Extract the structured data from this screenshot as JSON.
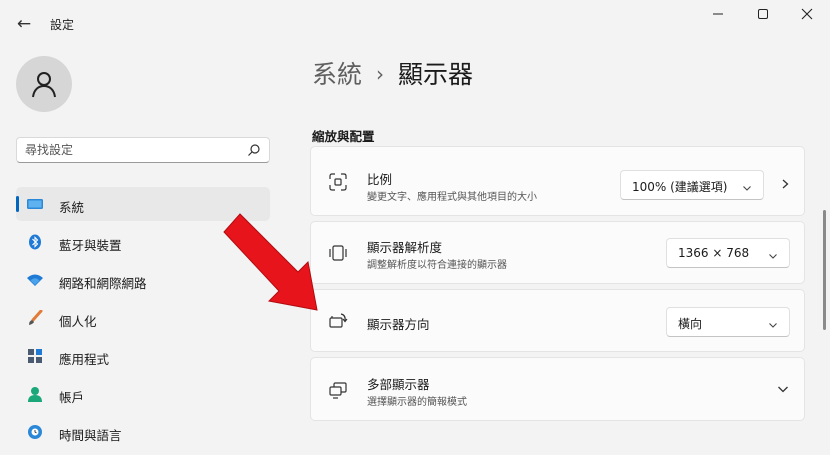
{
  "window": {
    "title": "設定",
    "back_icon": "arrow-left-icon",
    "controls": [
      "minimize-icon",
      "maximize-icon",
      "close-icon"
    ]
  },
  "sidebar": {
    "search_placeholder": "尋找設定",
    "items": [
      {
        "label": "系統",
        "icon": "system-display-icon",
        "active": true
      },
      {
        "label": "藍牙與裝置",
        "icon": "bluetooth-icon"
      },
      {
        "label": "網路和網際網路",
        "icon": "wifi-icon"
      },
      {
        "label": "個人化",
        "icon": "brush-icon"
      },
      {
        "label": "應用程式",
        "icon": "apps-icon"
      },
      {
        "label": "帳戶",
        "icon": "account-icon"
      },
      {
        "label": "時間與語言",
        "icon": "globe-clock-icon"
      }
    ]
  },
  "main": {
    "breadcrumb_parent": "系統",
    "breadcrumb_separator": "›",
    "breadcrumb_current": "顯示器",
    "section_title": "縮放與配置",
    "cards": {
      "scale": {
        "title": "比例",
        "desc": "變更文字、應用程式與其他項目的大小",
        "value": "100% (建議選項)",
        "icon": "scale-icon"
      },
      "resolution": {
        "title": "顯示器解析度",
        "desc": "調整解析度以符合連接的顯示器",
        "value": "1366 × 768",
        "icon": "resolution-icon"
      },
      "orientation": {
        "title": "顯示器方向",
        "value": "橫向",
        "icon": "orientation-icon"
      },
      "multi": {
        "title": "多部顯示器",
        "desc": "選擇顯示器的簡報模式",
        "icon": "multiple-displays-icon"
      }
    }
  },
  "colors": {
    "accent": "#0067c0",
    "annotation_arrow": "#e8141b"
  }
}
